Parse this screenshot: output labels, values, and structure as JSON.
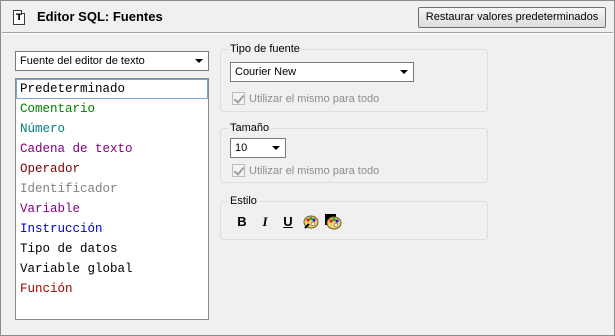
{
  "header": {
    "title": "Editor SQL: Fuentes",
    "restore_label": "Restaurar valores predeterminados"
  },
  "font_source_select": {
    "value": "Fuente del editor de texto"
  },
  "categories": [
    {
      "label": "Predeterminado",
      "color": "#000000"
    },
    {
      "label": "Comentario",
      "color": "#008000"
    },
    {
      "label": "Número",
      "color": "#008080"
    },
    {
      "label": "Cadena de texto",
      "color": "#800080"
    },
    {
      "label": "Operador",
      "color": "#800000"
    },
    {
      "label": "Identificador",
      "color": "#808080"
    },
    {
      "label": "Variable",
      "color": "#800080"
    },
    {
      "label": "Instrucción",
      "color": "#0000c0"
    },
    {
      "label": "Tipo de datos",
      "color": "#000000"
    },
    {
      "label": "Variable global",
      "color": "#000000"
    },
    {
      "label": "Función",
      "color": "#a00000"
    }
  ],
  "font_type": {
    "label": "Tipo de fuente",
    "value": "Courier New",
    "same_for_all": "Utilizar el mismo para todo"
  },
  "size": {
    "label": "Tamaño",
    "value": "10",
    "same_for_all": "Utilizar el mismo para todo"
  },
  "style": {
    "label": "Estilo",
    "bold": "B",
    "italic": "I",
    "underline": "U"
  }
}
